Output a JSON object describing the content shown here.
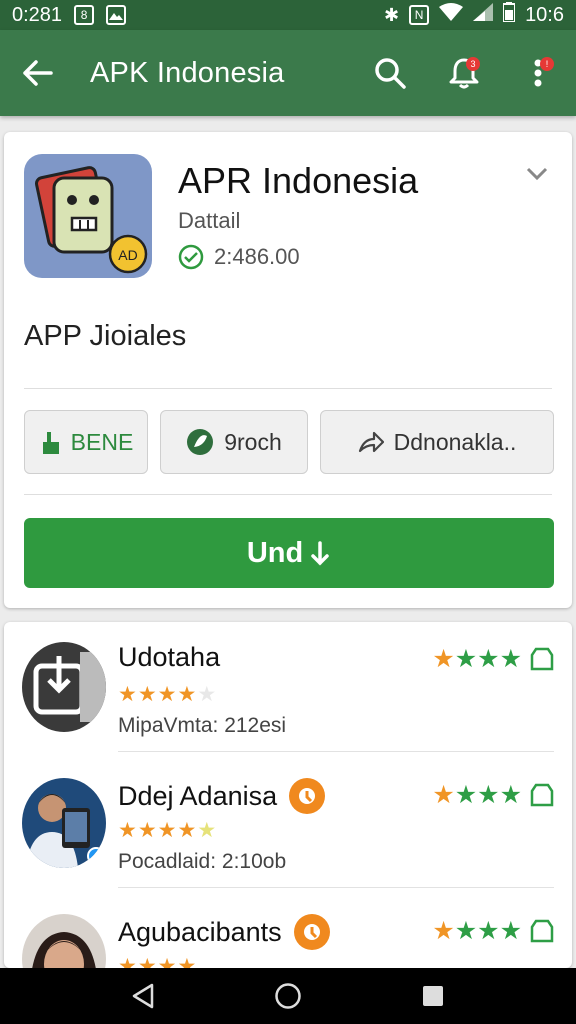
{
  "status_bar": {
    "time_left": "0:281",
    "time_right": "10:6",
    "icons": [
      "notification-icon",
      "image-icon",
      "bluetooth-icon",
      "nfc-icon",
      "wifi-icon",
      "signal-icon",
      "battery-icon"
    ]
  },
  "app_bar": {
    "title": "APK Indonesia",
    "notification_badge": "3",
    "menu_badge": "!"
  },
  "app_card": {
    "name": "APR Indonesia",
    "subtitle": "Dattail",
    "count": "2:486.00",
    "section_title": "APP Jioiales",
    "chips": [
      {
        "label": "BENE",
        "icon": "hand-icon"
      },
      {
        "label": "9roch",
        "icon": "leaf-icon"
      },
      {
        "label": "Ddnonakla..",
        "icon": "share-icon"
      }
    ],
    "install_label": "Und"
  },
  "list": {
    "items": [
      {
        "title": "Udotaha",
        "meta": "MipaVmta: 212esi",
        "stars_rating": 3.5,
        "verified": false
      },
      {
        "title": "Ddej Adanisa",
        "meta": "Pocadlaid: 2:10ob",
        "stars_rating": 4,
        "verified": true
      },
      {
        "title": "Agubacibants",
        "meta": "",
        "stars_rating": 4,
        "verified": true
      }
    ]
  },
  "colors": {
    "status_bar": "#2c6339",
    "app_bar": "#3b7a4b",
    "install": "#2f9a3f",
    "star_orange": "#f09526",
    "star_green": "#2e9e46"
  }
}
